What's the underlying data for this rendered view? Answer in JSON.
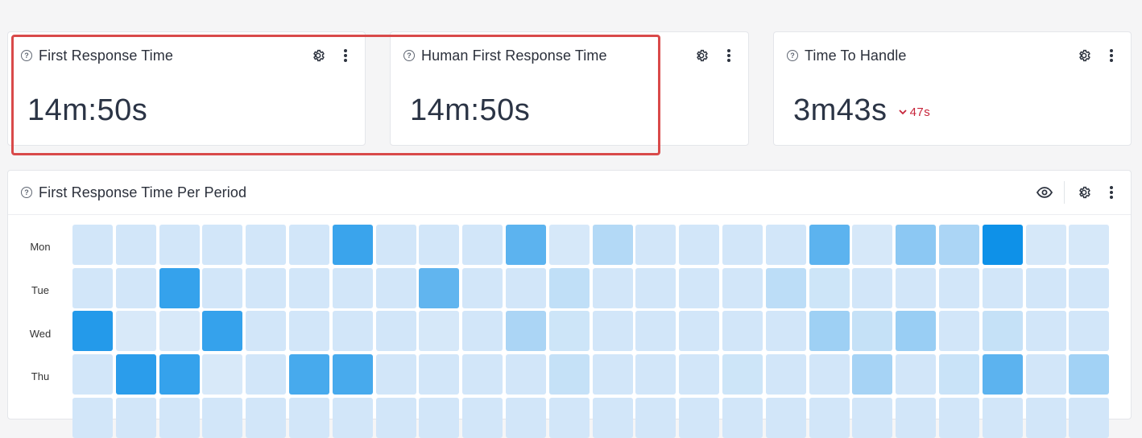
{
  "cards": [
    {
      "title": "First Response Time",
      "value": "14m:50s",
      "delta": ""
    },
    {
      "title": "Human First Response Time",
      "value": "14m:50s",
      "delta": ""
    },
    {
      "title": "Time To Handle",
      "value": "3m43s",
      "delta": "47s"
    }
  ],
  "panel": {
    "title": "First Response Time Per Period",
    "days": [
      "Mon",
      "Tue",
      "Wed",
      "Thu",
      ""
    ]
  },
  "colors": {
    "highlight": "#d94a4a",
    "delta_down": "#c7243a",
    "heat_base": "#e3eefa",
    "heat_strong": "#0a8fe8"
  },
  "heatmap": {
    "columns": 24,
    "rows": [
      [
        0.08,
        0.08,
        0.08,
        0.08,
        0.08,
        0.08,
        0.78,
        0.08,
        0.08,
        0.08,
        0.62,
        0.06,
        0.22,
        0.08,
        0.08,
        0.08,
        0.08,
        0.62,
        0.06,
        0.4,
        0.26,
        0.98,
        0.06,
        0.06
      ],
      [
        0.08,
        0.08,
        0.8,
        0.08,
        0.08,
        0.08,
        0.08,
        0.08,
        0.6,
        0.08,
        0.08,
        0.16,
        0.08,
        0.08,
        0.08,
        0.08,
        0.18,
        0.1,
        0.08,
        0.08,
        0.08,
        0.08,
        0.08,
        0.08
      ],
      [
        0.88,
        0.05,
        0.05,
        0.8,
        0.08,
        0.08,
        0.08,
        0.08,
        0.06,
        0.08,
        0.26,
        0.1,
        0.08,
        0.08,
        0.08,
        0.08,
        0.08,
        0.32,
        0.14,
        0.34,
        0.08,
        0.14,
        0.08,
        0.08
      ],
      [
        0.08,
        0.85,
        0.8,
        0.05,
        0.08,
        0.72,
        0.72,
        0.08,
        0.08,
        0.08,
        0.08,
        0.14,
        0.08,
        0.08,
        0.08,
        0.1,
        0.08,
        0.08,
        0.28,
        0.08,
        0.12,
        0.62,
        0.08,
        0.3
      ],
      [
        0.08,
        0.08,
        0.08,
        0.08,
        0.08,
        0.08,
        0.08,
        0.08,
        0.08,
        0.08,
        0.08,
        0.08,
        0.08,
        0.08,
        0.08,
        0.08,
        0.08,
        0.08,
        0.08,
        0.08,
        0.08,
        0.08,
        0.08,
        0.08
      ]
    ]
  }
}
